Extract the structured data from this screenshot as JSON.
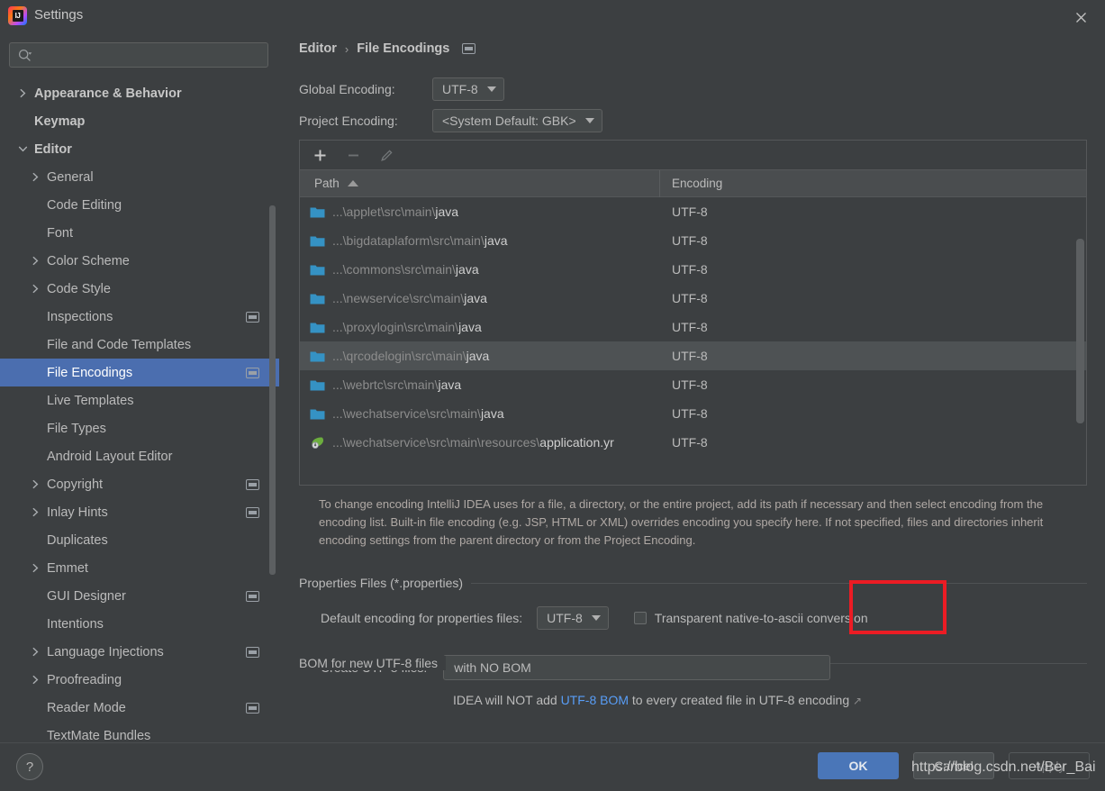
{
  "window": {
    "title": "Settings",
    "logo_text": "IJ",
    "close_icon": "close-icon"
  },
  "search": {
    "value": "",
    "placeholder": "",
    "icon": "search-icon"
  },
  "sidebar": {
    "items": [
      {
        "label": "Appearance & Behavior",
        "depth": 0,
        "expandable": true,
        "expanded": false,
        "selected": false,
        "ide_icon": false
      },
      {
        "label": "Keymap",
        "depth": 0,
        "expandable": false,
        "expanded": false,
        "selected": false,
        "ide_icon": false
      },
      {
        "label": "Editor",
        "depth": 0,
        "expandable": true,
        "expanded": true,
        "selected": false,
        "ide_icon": false
      },
      {
        "label": "General",
        "depth": 1,
        "expandable": true,
        "expanded": false,
        "selected": false,
        "ide_icon": false
      },
      {
        "label": "Code Editing",
        "depth": 1,
        "expandable": false,
        "expanded": false,
        "selected": false,
        "ide_icon": false
      },
      {
        "label": "Font",
        "depth": 1,
        "expandable": false,
        "expanded": false,
        "selected": false,
        "ide_icon": false
      },
      {
        "label": "Color Scheme",
        "depth": 1,
        "expandable": true,
        "expanded": false,
        "selected": false,
        "ide_icon": false
      },
      {
        "label": "Code Style",
        "depth": 1,
        "expandable": true,
        "expanded": false,
        "selected": false,
        "ide_icon": false
      },
      {
        "label": "Inspections",
        "depth": 1,
        "expandable": false,
        "expanded": false,
        "selected": false,
        "ide_icon": true
      },
      {
        "label": "File and Code Templates",
        "depth": 1,
        "expandable": false,
        "expanded": false,
        "selected": false,
        "ide_icon": false
      },
      {
        "label": "File Encodings",
        "depth": 1,
        "expandable": false,
        "expanded": false,
        "selected": true,
        "ide_icon": true
      },
      {
        "label": "Live Templates",
        "depth": 1,
        "expandable": false,
        "expanded": false,
        "selected": false,
        "ide_icon": false
      },
      {
        "label": "File Types",
        "depth": 1,
        "expandable": false,
        "expanded": false,
        "selected": false,
        "ide_icon": false
      },
      {
        "label": "Android Layout Editor",
        "depth": 1,
        "expandable": false,
        "expanded": false,
        "selected": false,
        "ide_icon": false
      },
      {
        "label": "Copyright",
        "depth": 1,
        "expandable": true,
        "expanded": false,
        "selected": false,
        "ide_icon": true
      },
      {
        "label": "Inlay Hints",
        "depth": 1,
        "expandable": true,
        "expanded": false,
        "selected": false,
        "ide_icon": true
      },
      {
        "label": "Duplicates",
        "depth": 1,
        "expandable": false,
        "expanded": false,
        "selected": false,
        "ide_icon": false
      },
      {
        "label": "Emmet",
        "depth": 1,
        "expandable": true,
        "expanded": false,
        "selected": false,
        "ide_icon": false
      },
      {
        "label": "GUI Designer",
        "depth": 1,
        "expandable": false,
        "expanded": false,
        "selected": false,
        "ide_icon": true
      },
      {
        "label": "Intentions",
        "depth": 1,
        "expandable": false,
        "expanded": false,
        "selected": false,
        "ide_icon": false
      },
      {
        "label": "Language Injections",
        "depth": 1,
        "expandable": true,
        "expanded": false,
        "selected": false,
        "ide_icon": true
      },
      {
        "label": "Proofreading",
        "depth": 1,
        "expandable": true,
        "expanded": false,
        "selected": false,
        "ide_icon": false
      },
      {
        "label": "Reader Mode",
        "depth": 1,
        "expandable": false,
        "expanded": false,
        "selected": false,
        "ide_icon": true
      },
      {
        "label": "TextMate Bundles",
        "depth": 1,
        "expandable": false,
        "expanded": false,
        "selected": false,
        "ide_icon": false
      }
    ]
  },
  "breadcrumb": {
    "root": "Editor",
    "separator": "›",
    "current": "File Encodings"
  },
  "encodings": {
    "global_label": "Global Encoding:",
    "global_value": "UTF-8",
    "project_label": "Project Encoding:",
    "project_value": "<System Default: GBK>"
  },
  "table": {
    "toolbar": {
      "add": "+",
      "remove": "−",
      "edit": "edit-pencil"
    },
    "columns": [
      "Path",
      "Encoding"
    ],
    "sort_column": "Path",
    "sort_direction": "asc",
    "rows": [
      {
        "path_prefix": "...\\applet\\src\\main\\",
        "path_tail": "java",
        "encoding": "UTF-8",
        "icon": "folder-icon",
        "selected": false
      },
      {
        "path_prefix": "...\\bigdataplaform\\src\\main\\",
        "path_tail": "java",
        "encoding": "UTF-8",
        "icon": "folder-icon",
        "selected": false
      },
      {
        "path_prefix": "...\\commons\\src\\main\\",
        "path_tail": "java",
        "encoding": "UTF-8",
        "icon": "folder-icon",
        "selected": false
      },
      {
        "path_prefix": "...\\newservice\\src\\main\\",
        "path_tail": "java",
        "encoding": "UTF-8",
        "icon": "folder-icon",
        "selected": false
      },
      {
        "path_prefix": "...\\proxylogin\\src\\main\\",
        "path_tail": "java",
        "encoding": "UTF-8",
        "icon": "folder-icon",
        "selected": false
      },
      {
        "path_prefix": "...\\qrcodelogin\\src\\main\\",
        "path_tail": "java",
        "encoding": "UTF-8",
        "icon": "folder-icon",
        "selected": true
      },
      {
        "path_prefix": "...\\webrtc\\src\\main\\",
        "path_tail": "java",
        "encoding": "UTF-8",
        "icon": "folder-icon",
        "selected": false
      },
      {
        "path_prefix": "...\\wechatservice\\src\\main\\",
        "path_tail": "java",
        "encoding": "UTF-8",
        "icon": "folder-icon",
        "selected": false
      },
      {
        "path_prefix": "...\\wechatservice\\src\\main\\resources\\",
        "path_tail": "application.yr",
        "encoding": "UTF-8",
        "icon": "spring-yaml-icon",
        "selected": false
      }
    ]
  },
  "description": "To change encoding IntelliJ IDEA uses for a file, a directory, or the entire project, add its path if necessary and then select encoding from the encoding list. Built-in file encoding (e.g. JSP, HTML or XML) overrides encoding you specify here. If not specified, files and directories inherit encoding settings from the parent directory or from the Project Encoding.",
  "properties_section": {
    "title": "Properties Files (*.properties)",
    "default_encoding_label": "Default encoding for properties files:",
    "default_encoding_value": "UTF-8",
    "transparent_checkbox_label": "Transparent native-to-ascii conversion",
    "transparent_checked": false
  },
  "bom_section": {
    "title": "BOM for new UTF-8 files",
    "create_label": "Create UTF-8 files:",
    "create_value": "with NO BOM",
    "hint_prefix": "IDEA will NOT add ",
    "hint_link": "UTF-8 BOM",
    "hint_suffix": " to every created file in UTF-8 encoding",
    "hint_arrow": "↗"
  },
  "footer": {
    "help": "?",
    "ok": "OK",
    "cancel": "Cancel",
    "apply": "Apply",
    "watermark": "https://blog.csdn.net/Ber_Bai"
  },
  "colors": {
    "accent_selection": "#4b6eaf",
    "ok_button": "#4a76b8",
    "link": "#589df6",
    "highlight_box": "#ec1c24",
    "folder_icon": "#3592c4",
    "background": "#3c3f41"
  }
}
